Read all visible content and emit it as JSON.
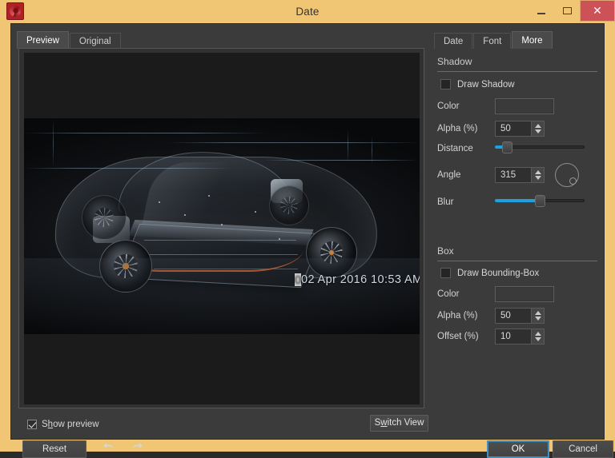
{
  "window": {
    "title": "Date",
    "icon": "app-swirl-icon",
    "minimize_label": "Minimize",
    "maximize_label": "Maximize",
    "close_label": "✕",
    "frame_color": "#f0c674",
    "client_color": "#3b3b3b"
  },
  "left": {
    "tabs": [
      {
        "label": "Preview",
        "active": true
      },
      {
        "label": "Original",
        "active": false
      }
    ],
    "preview": {
      "datestamp_text": "02 Apr 2016 10:53 AM",
      "image_description": "transparent electric car chassis render"
    },
    "show_preview": {
      "label_pre": "S",
      "label_accel": "h",
      "label_post": "ow preview",
      "checked": true
    },
    "switch_view": {
      "label_pre": "S",
      "label_accel": "w",
      "label_post": "itch View"
    }
  },
  "right": {
    "tabs": [
      {
        "label": "Date",
        "active": false
      },
      {
        "label": "Font",
        "active": false
      },
      {
        "label": "More",
        "active": true
      }
    ],
    "shadow": {
      "section_title": "Shadow",
      "draw_shadow": {
        "label": "Draw Shadow",
        "checked": false
      },
      "color_label": "Color",
      "color_value": "",
      "alpha_label": "Alpha (%)",
      "alpha_value": "50",
      "distance_label": "Distance",
      "distance_percent": 10,
      "angle_label": "Angle",
      "angle_value": "315",
      "blur_label": "Blur",
      "blur_percent": 50
    },
    "box": {
      "section_title": "Box",
      "draw_bounding_box": {
        "label": "Draw Bounding-Box",
        "checked": false
      },
      "color_label": "Color",
      "color_value": "",
      "alpha_label": "Alpha (%)",
      "alpha_value": "50",
      "offset_label": "Offset (%)",
      "offset_value": "10"
    }
  },
  "footer": {
    "reset_label": "Reset",
    "undo_icon": "⬅",
    "redo_icon": "➡",
    "ok_label": "OK",
    "cancel_label": "Cancel",
    "accent_color": "#3d8fc4"
  }
}
